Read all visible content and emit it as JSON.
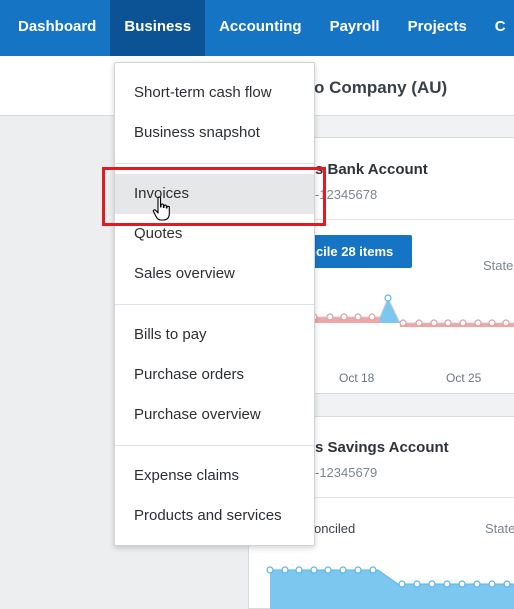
{
  "nav": {
    "items": [
      "Dashboard",
      "Business",
      "Accounting",
      "Payroll",
      "Projects",
      "C"
    ],
    "active": "Business"
  },
  "org": {
    "name": "o Company (AU)"
  },
  "dropdown": {
    "groups": [
      [
        "Short-term cash flow",
        "Business snapshot"
      ],
      [
        "Invoices",
        "Quotes",
        "Sales overview"
      ],
      [
        "Bills to pay",
        "Purchase orders",
        "Purchase overview"
      ],
      [
        "Expense claims",
        "Products and services"
      ]
    ],
    "hovered": "Invoices"
  },
  "card1": {
    "title": "s Bank Account",
    "account_number": "-12345678",
    "reconcile_label": "ncile 28 items",
    "statement_label": "State",
    "dates": [
      "Oct 18",
      "Oct 25"
    ]
  },
  "card2": {
    "title": "s Savings Account",
    "account_number": "-12345679",
    "reconciled_label": "onciled",
    "statement_label": "State"
  },
  "colors": {
    "nav_bg": "#1574c4",
    "nav_active": "#0b5394",
    "highlight": "#e11b22",
    "chart_red": "#f0a5a8",
    "chart_blue": "#7cc7ef"
  }
}
